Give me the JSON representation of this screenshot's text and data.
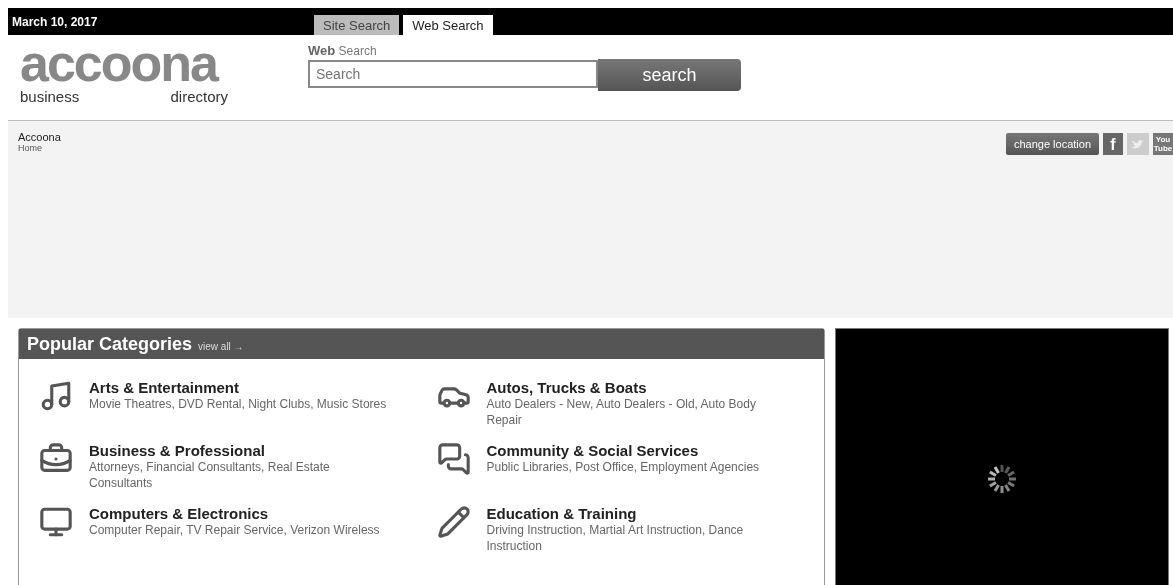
{
  "top_bar": {
    "date": "March 10, 2017",
    "tabs": [
      {
        "label": "Site Search",
        "selected": false
      },
      {
        "label": "Web Search",
        "selected": true
      }
    ]
  },
  "logo": {
    "wordmark": "accoona",
    "tagline_left": "business",
    "tagline_right": "directory"
  },
  "search": {
    "label_bold": "Web",
    "label": "Search",
    "placeholder": "Search",
    "button": "search"
  },
  "breadcrumb": {
    "title": "Accoona",
    "link": "Home"
  },
  "actions": {
    "button": "change location",
    "social": [
      {
        "kind": "facebook",
        "label": "f"
      },
      {
        "kind": "twitter"
      },
      {
        "kind": "youtube",
        "label_top": "You",
        "label_bottom": "Tube"
      }
    ]
  },
  "popular_categories": {
    "title": "Popular Categories",
    "link": "view all →",
    "items": [
      {
        "kind": "music",
        "name": "Arts & Entertainment",
        "sub": "Movie Theatres, DVD Rental, Night Clubs, Music Stores"
      },
      {
        "kind": "car",
        "name": "Autos, Trucks & Boats",
        "sub": "Auto Dealers - New, Auto Dealers - Old, Auto Body Repair"
      },
      {
        "kind": "toolbox",
        "name": "Business & Professional",
        "sub": "Attorneys, Financial Consultants, Real Estate Consultants"
      },
      {
        "kind": "chat",
        "name": "Community & Social Services",
        "sub": "Public Libraries, Post Office, Employment Agencies"
      },
      {
        "kind": "monitor",
        "name": "Computers & Electronics",
        "sub": "Computer Repair, TV Repair Service, Verizon Wireless"
      },
      {
        "kind": "pencil",
        "name": "Education & Training",
        "sub": "Driving Instruction, Martial Art Instruction, Dance Instruction"
      }
    ]
  },
  "video": {
    "kind": "loading"
  }
}
